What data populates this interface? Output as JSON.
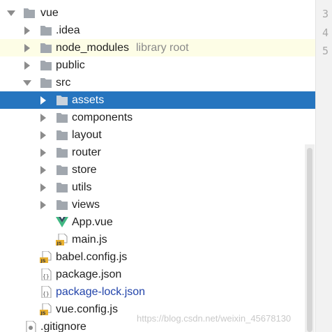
{
  "tree": {
    "rows": [
      {
        "label": "vue"
      },
      {
        "label": ".idea"
      },
      {
        "label": "node_modules",
        "hint": "library root"
      },
      {
        "label": "public"
      },
      {
        "label": "src"
      },
      {
        "label": "assets"
      },
      {
        "label": "components"
      },
      {
        "label": "layout"
      },
      {
        "label": "router"
      },
      {
        "label": "store"
      },
      {
        "label": "utils"
      },
      {
        "label": "views"
      },
      {
        "label": "App.vue"
      },
      {
        "label": "main.js"
      },
      {
        "label": "babel.config.js"
      },
      {
        "label": "package.json"
      },
      {
        "label": "package-lock.json"
      },
      {
        "label": "vue.config.js"
      },
      {
        "label": ".gitignore"
      }
    ]
  },
  "gutter": {
    "numbers": [
      "3",
      "4",
      "5"
    ]
  },
  "icons": {
    "folder": "folder-icon",
    "vue": "vue-file-icon",
    "js": "js-file-icon",
    "json": "json-file-icon",
    "git": "gitignore-file-icon"
  },
  "colors": {
    "selection": "#2675bf",
    "highlight_row": "#fdfde6",
    "folder": "#a1a7ae",
    "js_badge": "#e8b030",
    "vue_green": "#41b883",
    "vue_dark": "#34495e",
    "modified_file": "#2244aa"
  },
  "watermark": "https://blog.csdn.net/weixin_45678130"
}
